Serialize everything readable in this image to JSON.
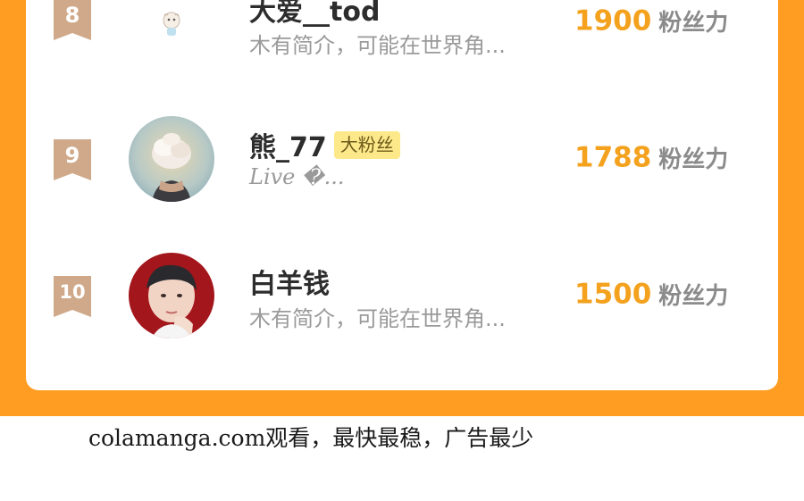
{
  "colors": {
    "accent_orange": "#ff9d22",
    "score_color": "#f4a11d",
    "rank_badge": "#cfa989",
    "fan_badge_bg": "#fde98a"
  },
  "leaderboard": [
    {
      "rank": "8",
      "avatar": "cartoon-sheep-avatar",
      "name": "大爱__tod",
      "badge": "",
      "bio": "木有简介，可能在世界角...",
      "score": "1900",
      "score_unit": "粉丝力"
    },
    {
      "rank": "9",
      "avatar": "cloud-portrait-avatar",
      "name": "熊_77",
      "badge": "大粉丝",
      "bio": "Live �...",
      "score": "1788",
      "score_unit": "粉丝力"
    },
    {
      "rank": "10",
      "avatar": "boy-portrait-avatar",
      "name": "白羊钱",
      "badge": "",
      "bio": "木有简介，可能在世界角...",
      "score": "1500",
      "score_unit": "粉丝力"
    }
  ],
  "footer": {
    "text": "colamanga.com观看，最快最稳，广告最少"
  }
}
